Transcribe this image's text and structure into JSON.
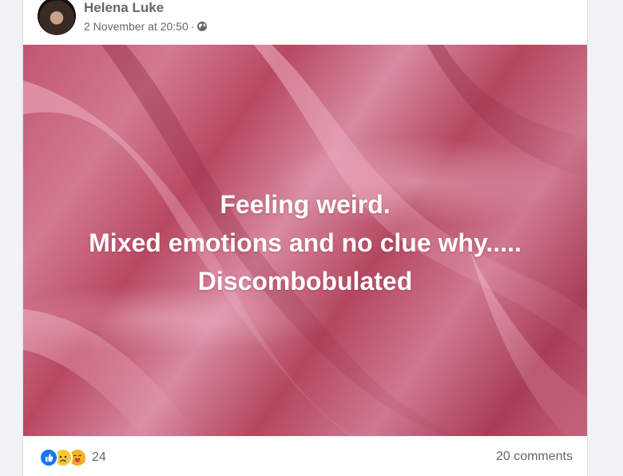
{
  "post": {
    "author": "Helena Luke",
    "timestamp": "2 November at 20:50",
    "separator": "·",
    "audience_icon": "globe-icon",
    "image_text_lines": [
      "Feeling weird.",
      "Mixed emotions and no clue why.....",
      "Discombobulated"
    ],
    "background_color": "#c0566f"
  },
  "footer": {
    "reaction_icons": [
      "like-icon",
      "sad-icon",
      "care-icon"
    ],
    "reaction_count": "24",
    "comments": "20 comments"
  }
}
